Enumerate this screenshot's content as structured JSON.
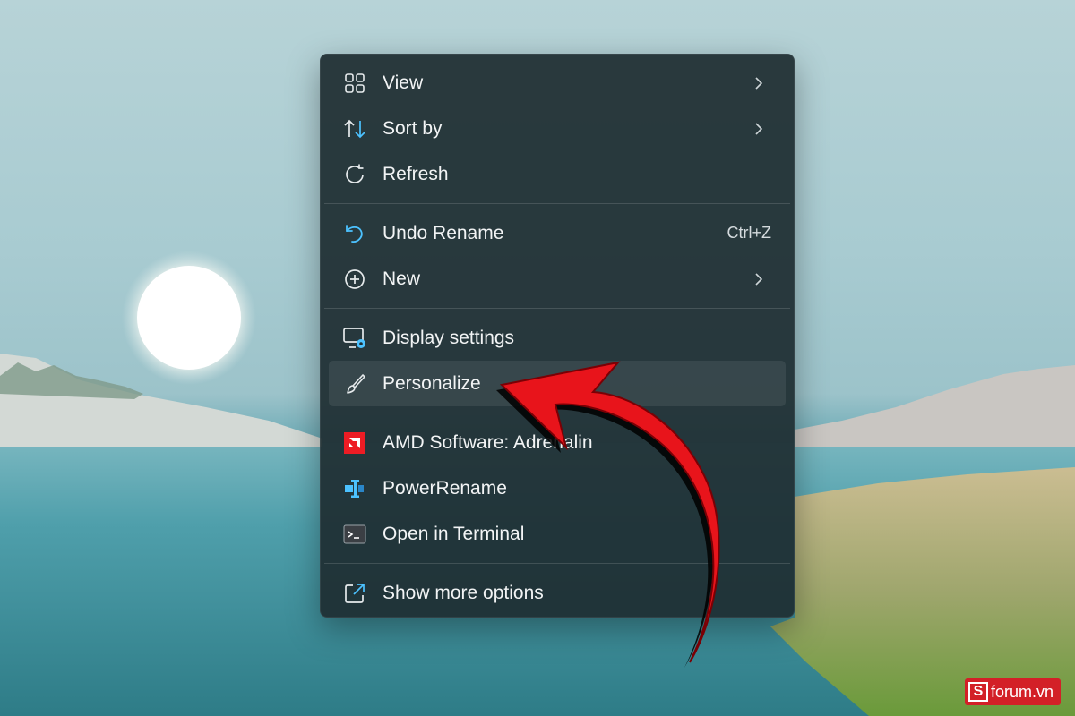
{
  "menu": {
    "sections": [
      [
        {
          "label": "View",
          "icon": "grid-view-icon",
          "submenu": true,
          "shortcut": ""
        },
        {
          "label": "Sort by",
          "icon": "sort-arrows-icon",
          "submenu": true,
          "shortcut": ""
        },
        {
          "label": "Refresh",
          "icon": "refresh-icon",
          "submenu": false,
          "shortcut": ""
        }
      ],
      [
        {
          "label": "Undo Rename",
          "icon": "undo-icon",
          "submenu": false,
          "shortcut": "Ctrl+Z"
        },
        {
          "label": "New",
          "icon": "plus-circle-icon",
          "submenu": true,
          "shortcut": ""
        }
      ],
      [
        {
          "label": "Display settings",
          "icon": "display-settings-icon",
          "submenu": false,
          "shortcut": ""
        },
        {
          "label": "Personalize",
          "icon": "paintbrush-icon",
          "submenu": false,
          "shortcut": "",
          "highlighted": true
        }
      ],
      [
        {
          "label": "AMD Software: Adrenalin",
          "icon": "amd-logo-icon",
          "submenu": false,
          "shortcut": ""
        },
        {
          "label": "PowerRename",
          "icon": "power-rename-icon",
          "submenu": false,
          "shortcut": ""
        },
        {
          "label": "Open in Terminal",
          "icon": "terminal-icon",
          "submenu": false,
          "shortcut": ""
        }
      ],
      [
        {
          "label": "Show more options",
          "icon": "expand-window-icon",
          "submenu": false,
          "shortcut": ""
        }
      ]
    ]
  },
  "annotation": {
    "arrow_color": "#e8141b",
    "pointing_to": "Personalize"
  },
  "watermark": {
    "badge": "S",
    "text": "forum.vn",
    "color": "#d32027"
  },
  "theme": {
    "menu_bg": "#1e2d32",
    "accent": "#4cc2ff",
    "text": "#f2f4f5"
  }
}
